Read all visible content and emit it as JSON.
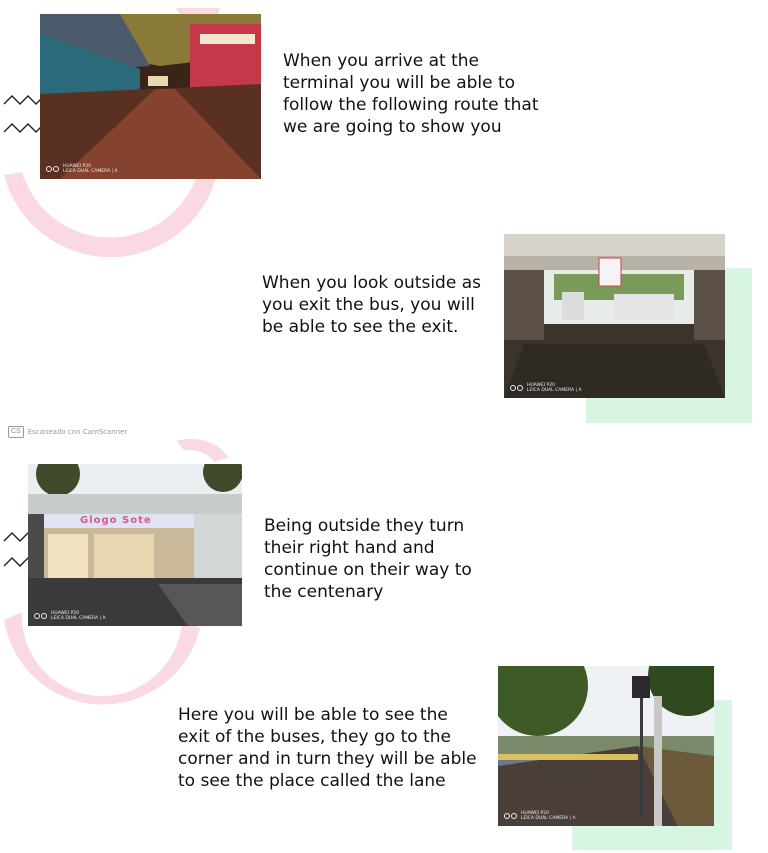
{
  "sections": [
    {
      "caption": "When you arrive at the terminal you will be able to follow the following route that we are going to show you"
    },
    {
      "caption": "When you look outside as you exit the bus, you will be able to see the exit."
    },
    {
      "caption": "Being outside they turn their right hand and continue on their way to the centenary"
    },
    {
      "caption": "Here you will be able to see the exit of the buses, they go to the corner and in turn they will be able to see the place called the lane"
    }
  ],
  "camera_tag": {
    "line1": "HUAWEI P20",
    "line2": "LEICA DUAL CAMERA | A"
  },
  "storefront_sign": "Glogo Sote",
  "watermark": {
    "badge": "CS",
    "text": "Escaneado con CamScanner"
  },
  "colors": {
    "pink": "#fbd9e2",
    "mint": "#d8f5e4",
    "zigzag": "#222222"
  }
}
